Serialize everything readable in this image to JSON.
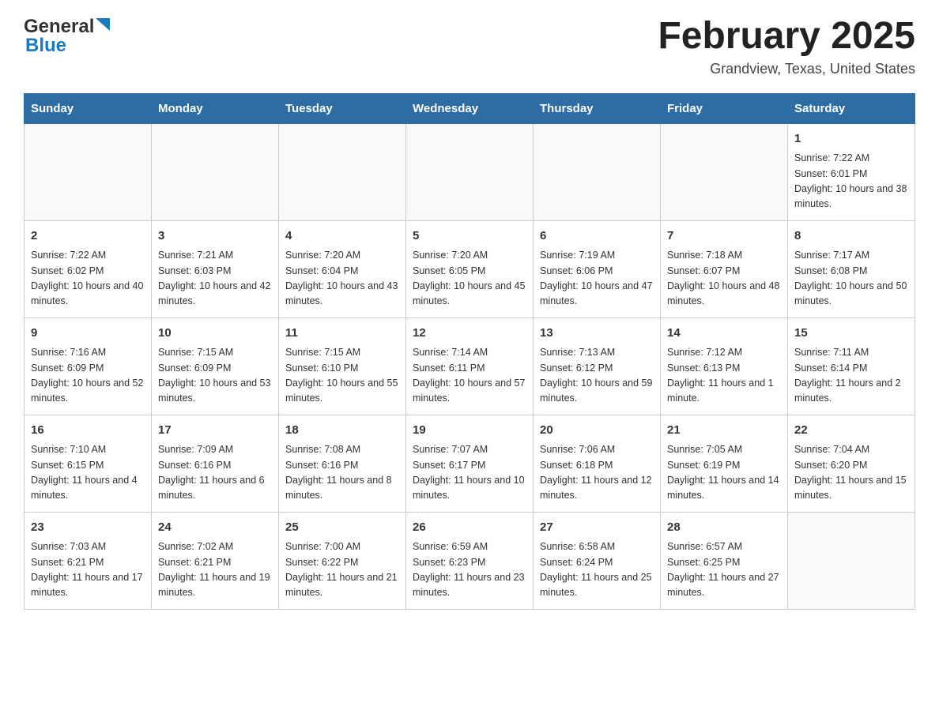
{
  "header": {
    "logo_text_general": "General",
    "logo_text_blue": "Blue",
    "month_title": "February 2025",
    "location": "Grandview, Texas, United States"
  },
  "days_of_week": [
    "Sunday",
    "Monday",
    "Tuesday",
    "Wednesday",
    "Thursday",
    "Friday",
    "Saturday"
  ],
  "weeks": [
    [
      {
        "day": "",
        "info": ""
      },
      {
        "day": "",
        "info": ""
      },
      {
        "day": "",
        "info": ""
      },
      {
        "day": "",
        "info": ""
      },
      {
        "day": "",
        "info": ""
      },
      {
        "day": "",
        "info": ""
      },
      {
        "day": "1",
        "info": "Sunrise: 7:22 AM\nSunset: 6:01 PM\nDaylight: 10 hours and 38 minutes."
      }
    ],
    [
      {
        "day": "2",
        "info": "Sunrise: 7:22 AM\nSunset: 6:02 PM\nDaylight: 10 hours and 40 minutes."
      },
      {
        "day": "3",
        "info": "Sunrise: 7:21 AM\nSunset: 6:03 PM\nDaylight: 10 hours and 42 minutes."
      },
      {
        "day": "4",
        "info": "Sunrise: 7:20 AM\nSunset: 6:04 PM\nDaylight: 10 hours and 43 minutes."
      },
      {
        "day": "5",
        "info": "Sunrise: 7:20 AM\nSunset: 6:05 PM\nDaylight: 10 hours and 45 minutes."
      },
      {
        "day": "6",
        "info": "Sunrise: 7:19 AM\nSunset: 6:06 PM\nDaylight: 10 hours and 47 minutes."
      },
      {
        "day": "7",
        "info": "Sunrise: 7:18 AM\nSunset: 6:07 PM\nDaylight: 10 hours and 48 minutes."
      },
      {
        "day": "8",
        "info": "Sunrise: 7:17 AM\nSunset: 6:08 PM\nDaylight: 10 hours and 50 minutes."
      }
    ],
    [
      {
        "day": "9",
        "info": "Sunrise: 7:16 AM\nSunset: 6:09 PM\nDaylight: 10 hours and 52 minutes."
      },
      {
        "day": "10",
        "info": "Sunrise: 7:15 AM\nSunset: 6:09 PM\nDaylight: 10 hours and 53 minutes."
      },
      {
        "day": "11",
        "info": "Sunrise: 7:15 AM\nSunset: 6:10 PM\nDaylight: 10 hours and 55 minutes."
      },
      {
        "day": "12",
        "info": "Sunrise: 7:14 AM\nSunset: 6:11 PM\nDaylight: 10 hours and 57 minutes."
      },
      {
        "day": "13",
        "info": "Sunrise: 7:13 AM\nSunset: 6:12 PM\nDaylight: 10 hours and 59 minutes."
      },
      {
        "day": "14",
        "info": "Sunrise: 7:12 AM\nSunset: 6:13 PM\nDaylight: 11 hours and 1 minute."
      },
      {
        "day": "15",
        "info": "Sunrise: 7:11 AM\nSunset: 6:14 PM\nDaylight: 11 hours and 2 minutes."
      }
    ],
    [
      {
        "day": "16",
        "info": "Sunrise: 7:10 AM\nSunset: 6:15 PM\nDaylight: 11 hours and 4 minutes."
      },
      {
        "day": "17",
        "info": "Sunrise: 7:09 AM\nSunset: 6:16 PM\nDaylight: 11 hours and 6 minutes."
      },
      {
        "day": "18",
        "info": "Sunrise: 7:08 AM\nSunset: 6:16 PM\nDaylight: 11 hours and 8 minutes."
      },
      {
        "day": "19",
        "info": "Sunrise: 7:07 AM\nSunset: 6:17 PM\nDaylight: 11 hours and 10 minutes."
      },
      {
        "day": "20",
        "info": "Sunrise: 7:06 AM\nSunset: 6:18 PM\nDaylight: 11 hours and 12 minutes."
      },
      {
        "day": "21",
        "info": "Sunrise: 7:05 AM\nSunset: 6:19 PM\nDaylight: 11 hours and 14 minutes."
      },
      {
        "day": "22",
        "info": "Sunrise: 7:04 AM\nSunset: 6:20 PM\nDaylight: 11 hours and 15 minutes."
      }
    ],
    [
      {
        "day": "23",
        "info": "Sunrise: 7:03 AM\nSunset: 6:21 PM\nDaylight: 11 hours and 17 minutes."
      },
      {
        "day": "24",
        "info": "Sunrise: 7:02 AM\nSunset: 6:21 PM\nDaylight: 11 hours and 19 minutes."
      },
      {
        "day": "25",
        "info": "Sunrise: 7:00 AM\nSunset: 6:22 PM\nDaylight: 11 hours and 21 minutes."
      },
      {
        "day": "26",
        "info": "Sunrise: 6:59 AM\nSunset: 6:23 PM\nDaylight: 11 hours and 23 minutes."
      },
      {
        "day": "27",
        "info": "Sunrise: 6:58 AM\nSunset: 6:24 PM\nDaylight: 11 hours and 25 minutes."
      },
      {
        "day": "28",
        "info": "Sunrise: 6:57 AM\nSunset: 6:25 PM\nDaylight: 11 hours and 27 minutes."
      },
      {
        "day": "",
        "info": ""
      }
    ]
  ]
}
